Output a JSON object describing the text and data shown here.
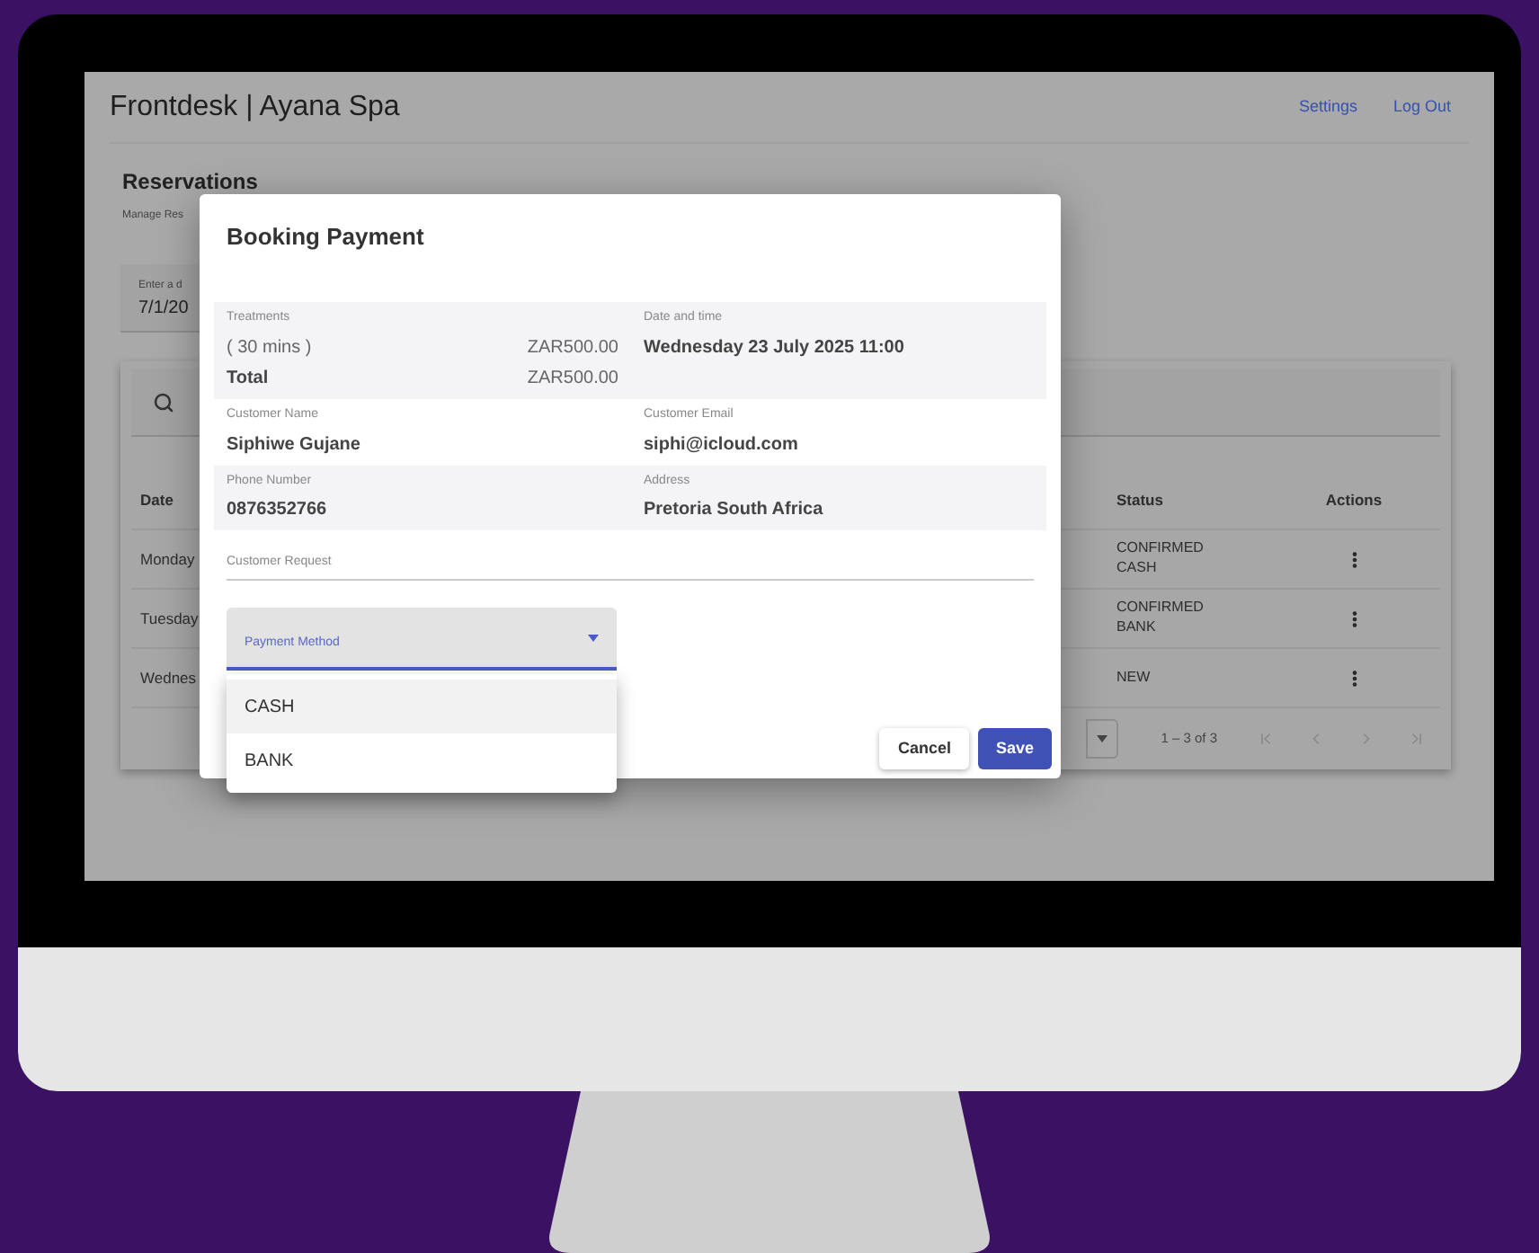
{
  "app": {
    "title": "Frontdesk | Ayana Spa",
    "nav_links": [
      "Settings",
      "Log Out"
    ],
    "page_title": "Reservations",
    "page_subtitle": "Manage Res",
    "date_field": {
      "label": "Enter a d",
      "value": "7/1/20"
    },
    "table": {
      "columns": [
        "Date",
        "Status",
        "Actions"
      ],
      "rows": [
        {
          "date": "Monday",
          "status": "CONFIRMED CASH"
        },
        {
          "date": "Tuesday",
          "status": "CONFIRMED BANK"
        },
        {
          "date": "Wednes",
          "status": "NEW"
        }
      ]
    },
    "pagination": {
      "range": "1 – 3 of 3"
    }
  },
  "dialog": {
    "title": "Booking Payment",
    "treatments_label": "Treatments",
    "treatments": [
      {
        "name": "( 30 mins )",
        "price": "ZAR500.00"
      }
    ],
    "total_label": "Total",
    "total": "ZAR500.00",
    "date_label": "Date and time",
    "date_value": "Wednesday 23 July 2025 11:00",
    "fields": [
      {
        "label": "Customer Name",
        "value": "Siphiwe Gujane"
      },
      {
        "label": "Customer Email",
        "value": "siphi@icloud.com"
      },
      {
        "label": "Phone Number",
        "value": "0876352766"
      },
      {
        "label": "Address",
        "value": "Pretoria South Africa"
      }
    ],
    "request_label": "Customer Request",
    "payment_method": {
      "label": "Payment Method",
      "options": [
        {
          "label": "CASH",
          "highlighted": true
        },
        {
          "label": "BANK",
          "highlighted": false
        }
      ]
    },
    "buttons": [
      {
        "label": "Cancel",
        "kind": "secondary"
      },
      {
        "label": "Save",
        "kind": "primary"
      }
    ]
  }
}
